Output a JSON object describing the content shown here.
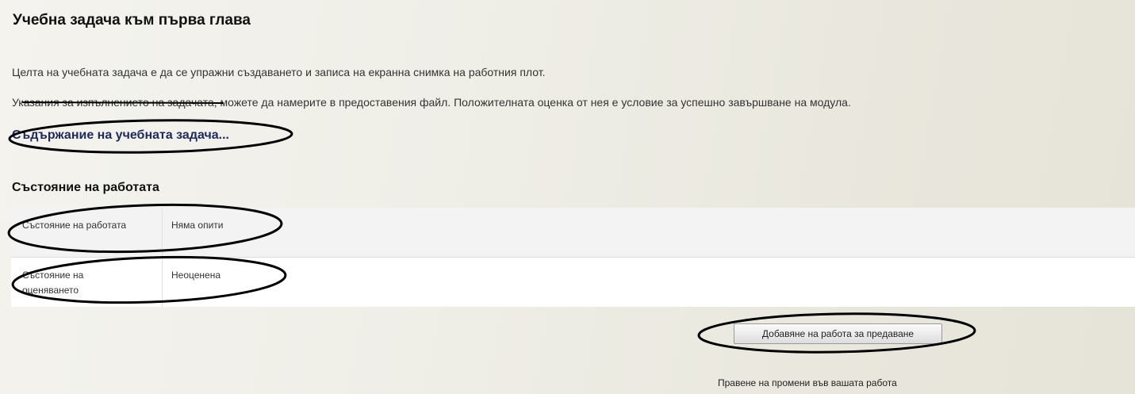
{
  "assignment": {
    "title": "Учебна задача към първа глава",
    "intro_lines": [
      "Целта на учебната задача е да се упражни създаването и записа на екранна снимка на работния плот.",
      "Указания за изпълнението на задачата, можете да намерите в предоставения файл. Положителната оценка от нея е условие за успешно завършване на модула."
    ],
    "content_link": "Съдържание на учебната задача..."
  },
  "submission_status": {
    "heading": "Състояние на работата",
    "rows": [
      {
        "label": "Състояние на работата",
        "value": "Няма опити"
      },
      {
        "label": "Състояние на оценяването",
        "value": "Неоценена"
      }
    ]
  },
  "actions": {
    "add_submission_button": "Добавяне на работа за предаване",
    "help_text": "Правене на промени във вашата работа"
  },
  "colors": {
    "link": "#1e2a5c",
    "annotation": "#000000"
  }
}
